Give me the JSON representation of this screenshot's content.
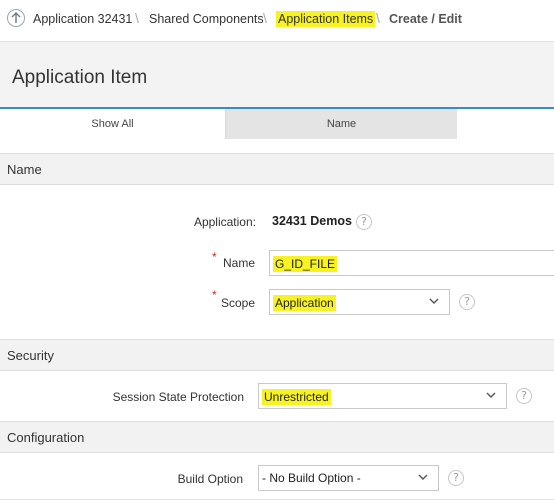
{
  "breadcrumb": {
    "items": [
      "Application 32431",
      "Shared Components",
      "Application Items"
    ],
    "current": "Create / Edit",
    "separator": "\\"
  },
  "page": {
    "title": "Application Item"
  },
  "tabs": [
    {
      "label": "Show All",
      "active": true
    },
    {
      "label": "Name",
      "active": false
    }
  ],
  "sections": {
    "name": "Name",
    "security": "Security",
    "configuration": "Configuration"
  },
  "form": {
    "application": {
      "label": "Application:",
      "value": "32431 Demos"
    },
    "name": {
      "label": "Name",
      "value": "G_ID_FILE",
      "required": true
    },
    "scope": {
      "label": "Scope",
      "value": "Application",
      "required": true
    },
    "session_state_protection": {
      "label": "Session State Protection",
      "value": "Unrestricted"
    },
    "build_option": {
      "label": "Build Option",
      "value": "- No Build Option -"
    }
  },
  "icons": {
    "up": "arrow-up-circle-icon",
    "help": "?",
    "dropdown": "chevron-down-icon"
  },
  "colors": {
    "highlight": "#f7f224",
    "accent": "#3a8bcd",
    "required": "#d0281d"
  }
}
